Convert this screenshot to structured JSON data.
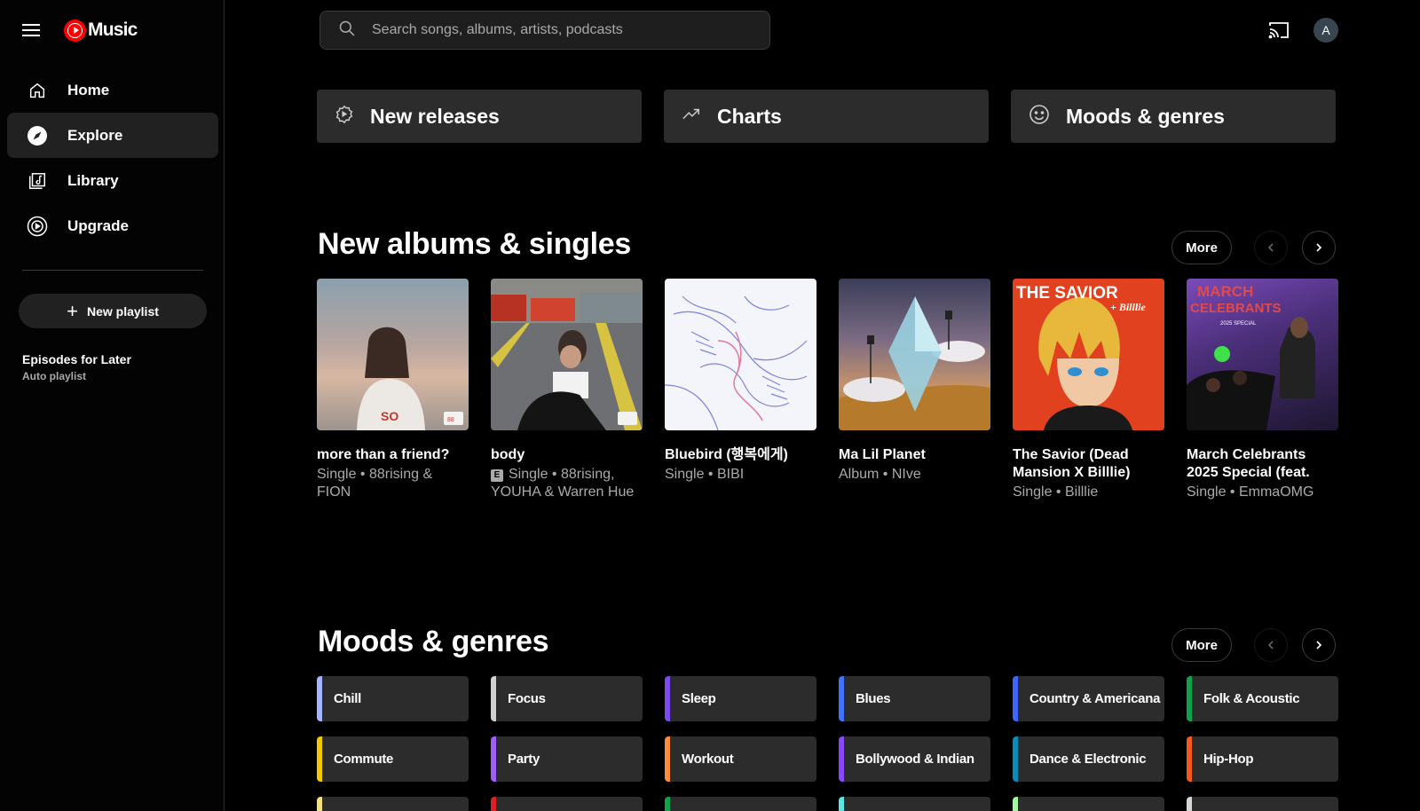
{
  "app": {
    "logo_text": "Music",
    "avatar_letter": "A"
  },
  "search": {
    "placeholder": "Search songs, albums, artists, podcasts"
  },
  "sidebar": {
    "items": [
      {
        "label": "Home",
        "icon": "home-icon"
      },
      {
        "label": "Explore",
        "icon": "compass-icon",
        "active": true
      },
      {
        "label": "Library",
        "icon": "library-icon"
      },
      {
        "label": "Upgrade",
        "icon": "upgrade-icon"
      }
    ],
    "new_playlist": "New playlist",
    "playlists": [
      {
        "title": "Episodes for Later",
        "subtitle": "Auto playlist"
      }
    ]
  },
  "explore_buttons": [
    {
      "label": "New releases",
      "icon": "new-releases-icon"
    },
    {
      "label": "Charts",
      "icon": "trending-icon"
    },
    {
      "label": "Moods & genres",
      "icon": "smiley-icon"
    }
  ],
  "new_albums": {
    "title": "New albums & singles",
    "more": "More",
    "items": [
      {
        "title": "more than a friend?",
        "subtitle": "Single • 88rising & FION",
        "explicit": false
      },
      {
        "title": "body",
        "subtitle": "Single • 88rising, YOUHA & Warren Hue",
        "explicit": true
      },
      {
        "title": "Bluebird (행복에게)",
        "subtitle": "Single • BIBI",
        "explicit": false
      },
      {
        "title": "Ma Lil Planet",
        "subtitle": "Album • NIve",
        "explicit": false
      },
      {
        "title": "The Savior (Dead Mansion X Billlie)",
        "subtitle": "Single • Billlie",
        "explicit": false
      },
      {
        "title": "March Celebrants 2025 Special (feat.",
        "subtitle": "Single • EmmaOMG",
        "explicit": false
      }
    ],
    "cover_text": {
      "savior": "THE SAVIOR",
      "savior_sub": "+ Billlie",
      "march": "MARCH CELEBRANTS",
      "march_sub": "2025 SPECIAL"
    }
  },
  "moods": {
    "title": "Moods & genres",
    "more": "More",
    "items": [
      {
        "label": "Chill",
        "color": "#a5b5ff"
      },
      {
        "label": "Focus",
        "color": "#d0d0d0"
      },
      {
        "label": "Sleep",
        "color": "#7d4af0"
      },
      {
        "label": "Blues",
        "color": "#3f73ff"
      },
      {
        "label": "Country & Americana",
        "color": "#3f66ff"
      },
      {
        "label": "Folk & Acoustic",
        "color": "#0ea34b"
      },
      {
        "label": "Commute",
        "color": "#f5c800"
      },
      {
        "label": "Party",
        "color": "#a25bff"
      },
      {
        "label": "Workout",
        "color": "#ff8a3d"
      },
      {
        "label": "Bollywood & Indian",
        "color": "#8b47ff"
      },
      {
        "label": "Dance & Electronic",
        "color": "#0b8cb8"
      },
      {
        "label": "Hip-Hop",
        "color": "#f05a1a"
      }
    ],
    "next_row_colors": [
      "#f3e27a",
      "#e02020",
      "#12a24b",
      "#5ce6e6",
      "#a6f5a0",
      "#d6d6d6"
    ]
  }
}
